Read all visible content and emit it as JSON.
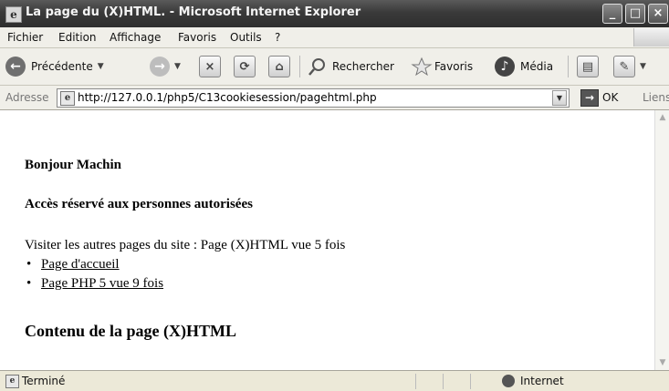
{
  "window": {
    "title": "La page du (X)HTML. - Microsoft Internet Explorer"
  },
  "menubar": {
    "items": [
      "Fichier",
      "Edition",
      "Affichage",
      "Favoris",
      "Outils",
      "?"
    ]
  },
  "toolbar": {
    "back_label": "Précédente",
    "search_label": "Rechercher",
    "favorites_label": "Favoris",
    "media_label": "Média"
  },
  "addressbar": {
    "label": "Adresse",
    "url": "http://127.0.0.1/php5/C13cookiesession/pagehtml.php",
    "go_label": "OK",
    "links_label": "Liens"
  },
  "content": {
    "greeting": "Bonjour Machin",
    "restricted_heading": "Accès réservé aux personnes autorisées",
    "visit_text": "Visiter les autres pages du site : Page (X)HTML vue 5 fois",
    "links": [
      "Page d'accueil",
      "Page PHP 5 vue 9 fois"
    ],
    "content_heading": "Contenu de la page (X)HTML"
  },
  "statusbar": {
    "status": "Terminé",
    "zone": "Internet"
  },
  "icons": {
    "back": "back-arrow-icon",
    "forward": "forward-arrow-icon",
    "stop": "stop-icon",
    "refresh": "refresh-icon",
    "home": "home-icon",
    "search": "search-icon",
    "favorites": "star-icon",
    "media": "media-icon",
    "print": "print-icon",
    "edit": "edit-icon"
  }
}
